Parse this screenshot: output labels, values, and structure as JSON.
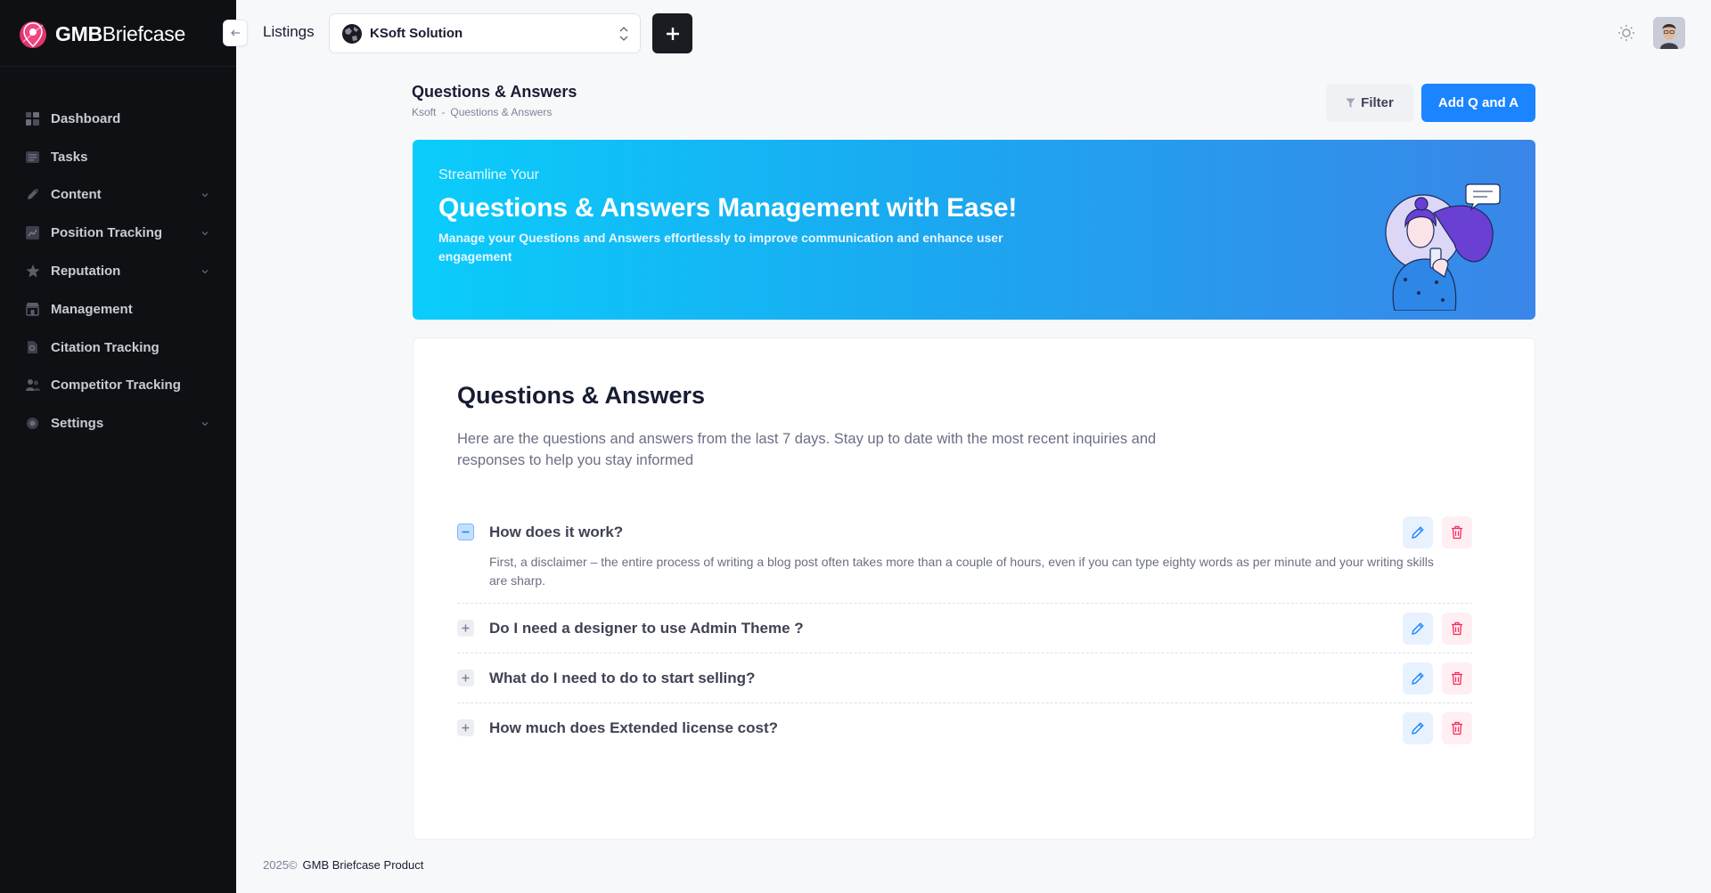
{
  "brand": {
    "name_bold": "GMB",
    "name_light": "Briefcase"
  },
  "sidebar": {
    "items": [
      {
        "label": "Dashboard",
        "icon": "grid-icon",
        "has_children": false
      },
      {
        "label": "Tasks",
        "icon": "tasks-icon",
        "has_children": false
      },
      {
        "label": "Content",
        "icon": "pen-icon",
        "has_children": true
      },
      {
        "label": "Position Tracking",
        "icon": "chart-icon",
        "has_children": true
      },
      {
        "label": "Reputation",
        "icon": "star-icon",
        "has_children": true
      },
      {
        "label": "Management",
        "icon": "store-icon",
        "has_children": false
      },
      {
        "label": "Citation Tracking",
        "icon": "document-icon",
        "has_children": false
      },
      {
        "label": "Competitor Tracking",
        "icon": "users-icon",
        "has_children": false
      },
      {
        "label": "Settings",
        "icon": "gear-icon",
        "has_children": true
      }
    ]
  },
  "topbar": {
    "title": "Listings",
    "listing_select": {
      "value": "KSoft Solution"
    }
  },
  "page": {
    "title": "Questions & Answers",
    "breadcrumb": [
      "Ksoft",
      "Questions & Answers"
    ],
    "breadcrumb_sep": "-",
    "filter_label": "Filter",
    "add_label": "Add Q and A"
  },
  "banner": {
    "subtitle": "Streamline Your",
    "title": "Questions & Answers Management with Ease!",
    "description": "Manage your Questions and Answers effortlessly to improve communication and enhance user engagement"
  },
  "qa_card": {
    "title": "Questions & Answers",
    "description": "Here are the questions and answers from the last 7 days. Stay up to date with the most recent inquiries and responses to help you stay informed",
    "items": [
      {
        "question": "How does it work?",
        "answer": "First, a disclaimer – the entire process of writing a blog post often takes more than a couple of hours, even if you can type eighty words as per minute and your writing skills are sharp.",
        "expanded": true
      },
      {
        "question": "Do I need a designer to use Admin Theme ?",
        "expanded": false
      },
      {
        "question": "What do I need to do to start selling?",
        "expanded": false
      },
      {
        "question": "How much does Extended license cost?",
        "expanded": false
      }
    ]
  },
  "footer": {
    "year": "2025©",
    "text": "GMB Briefcase Product"
  },
  "colors": {
    "sidebar_bg": "#0f1014",
    "primary": "#1b84ff",
    "banner_start": "#0acdfb",
    "banner_end": "#3a86e8",
    "danger": "#f8285a"
  }
}
